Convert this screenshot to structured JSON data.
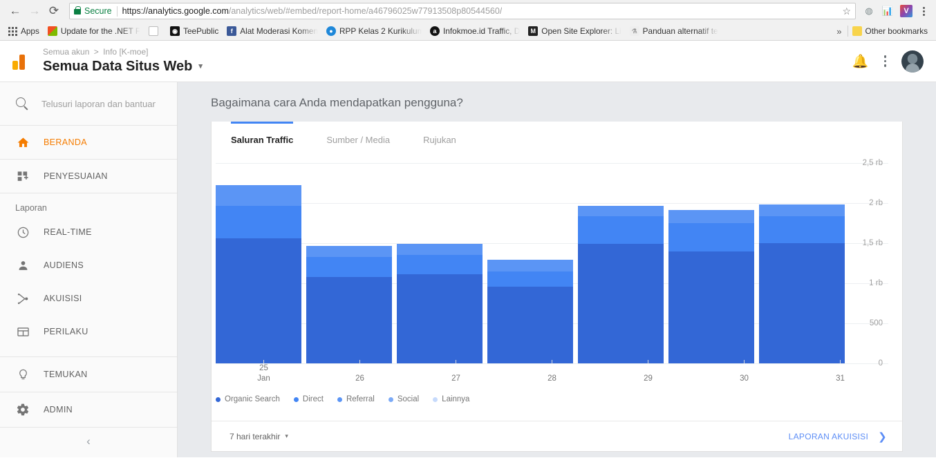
{
  "browser": {
    "back_icon": "back-arrow-icon",
    "forward_icon": "forward-arrow-icon",
    "reload_icon": "reload-icon",
    "secure_label": "Secure",
    "url_host": "https://analytics.google.com",
    "url_path": "/analytics/web/#embed/report-home/a46796025w77913508p80544560/",
    "star_icon": "bookmark-star-icon",
    "extensions": [
      "extension-globe-icon",
      "extension-chart-icon",
      "extension-v-icon"
    ],
    "menu_icon": "chrome-menu-icon",
    "bookmarks": [
      {
        "label": "Apps",
        "fav": "apps-grid-icon",
        "color": ""
      },
      {
        "label": "Update for the .NET F",
        "fav": "windows-icon",
        "color": "#f25022"
      },
      {
        "label": "",
        "fav": "page-icon",
        "color": "#ffffff"
      },
      {
        "label": "TeePublic",
        "fav": "teepublic-icon",
        "color": "#111111"
      },
      {
        "label": "Alat Moderasi Komen",
        "fav": "facebook-icon",
        "color": "#3b5998"
      },
      {
        "label": "RPP Kelas 2 Kurikulum",
        "fav": "doraemon-icon",
        "color": "#1f88d9"
      },
      {
        "label": "Infokmoe.id Traffic, D",
        "fav": "alexa-icon",
        "color": "#111111"
      },
      {
        "label": "Open Site Explorer: Li",
        "fav": "moz-icon",
        "color": "#222222"
      },
      {
        "label": "Panduan alternatif te",
        "fav": "doc-icon",
        "color": "#eeeeee"
      }
    ],
    "more_bookmarks_icon": "chevron-double-right-icon",
    "other_bookmarks": "Other bookmarks",
    "other_bookmarks_icon": "folder-icon"
  },
  "ga_header": {
    "logo": "google-analytics-logo",
    "breadcrumb_account": "Semua akun",
    "breadcrumb_sep": ">",
    "breadcrumb_property": "Info [K-moe]",
    "view_title": "Semua Data Situs Web",
    "view_caret": "▾",
    "notifications_icon": "bell-icon",
    "more_icon": "vertical-dots-icon",
    "avatar": "user-avatar"
  },
  "sidebar": {
    "search_placeholder": "Telusuri laporan dan bantuan",
    "search_icon": "search-icon",
    "section_label": "Laporan",
    "items": [
      {
        "label": "BERANDA",
        "icon": "home-icon",
        "active": true
      },
      {
        "label": "PENYESUAIAN",
        "icon": "customization-icon",
        "active": false
      },
      {
        "label": "REAL-TIME",
        "icon": "clock-icon",
        "active": false
      },
      {
        "label": "AUDIENS",
        "icon": "person-icon",
        "active": false
      },
      {
        "label": "AKUISISI",
        "icon": "share-nodes-icon",
        "active": false
      },
      {
        "label": "PERILAKU",
        "icon": "behavior-icon",
        "active": false
      },
      {
        "label": "TEMUKAN",
        "icon": "lightbulb-icon",
        "active": false
      },
      {
        "label": "ADMIN",
        "icon": "gear-icon",
        "active": false
      }
    ],
    "collapse_icon": "chevron-left-icon"
  },
  "main": {
    "title": "Bagaimana cara Anda mendapatkan pengguna?",
    "tabs": [
      {
        "label": "Saluran Traffic",
        "active": true
      },
      {
        "label": "Sumber / Media",
        "active": false
      },
      {
        "label": "Rujukan",
        "active": false
      }
    ],
    "footer": {
      "date_range": "7 hari terakhir",
      "date_caret": "▾",
      "report_link": "LAPORAN AKUISISI",
      "report_chev": "❯"
    }
  },
  "colors": {
    "accent_blue": "#4285f4",
    "orange": "#f57c00",
    "series": [
      "#3367d6",
      "#4285f4",
      "#5b95f5",
      "#7baaf7",
      "#c6dafc"
    ]
  },
  "chart_data": {
    "type": "bar",
    "stacked": true,
    "categories": [
      "25",
      "26",
      "27",
      "28",
      "29",
      "30",
      "31"
    ],
    "category_sublabels": [
      "Jan",
      "",
      "",
      "",
      "",
      "",
      ""
    ],
    "series": [
      {
        "name": "Organic Search",
        "color": "#3367d6",
        "values": [
          1560,
          1080,
          1110,
          960,
          1490,
          1400,
          1500
        ]
      },
      {
        "name": "Direct",
        "color": "#4285f4",
        "values": [
          405,
          245,
          240,
          190,
          345,
          350,
          340
        ]
      },
      {
        "name": "Referral",
        "color": "#5b95f5",
        "values": [
          260,
          145,
          145,
          140,
          135,
          160,
          140
        ]
      },
      {
        "name": "Social",
        "color": "#7baaf7",
        "values": [
          0,
          0,
          0,
          0,
          0,
          0,
          0
        ]
      },
      {
        "name": "Lainnya",
        "color": "#c6dafc",
        "values": [
          0,
          0,
          0,
          0,
          0,
          0,
          0
        ]
      }
    ],
    "ytick_labels": [
      "2,5 rb",
      "2 rb",
      "1,5 rb",
      "1 rb",
      "500",
      "0"
    ],
    "ytick_values": [
      2500,
      2000,
      1500,
      1000,
      500,
      0
    ],
    "ylim": [
      0,
      2500
    ],
    "grid": true,
    "legend_position": "bottom-left",
    "title": "Bagaimana cara Anda mendapatkan pengguna?"
  }
}
